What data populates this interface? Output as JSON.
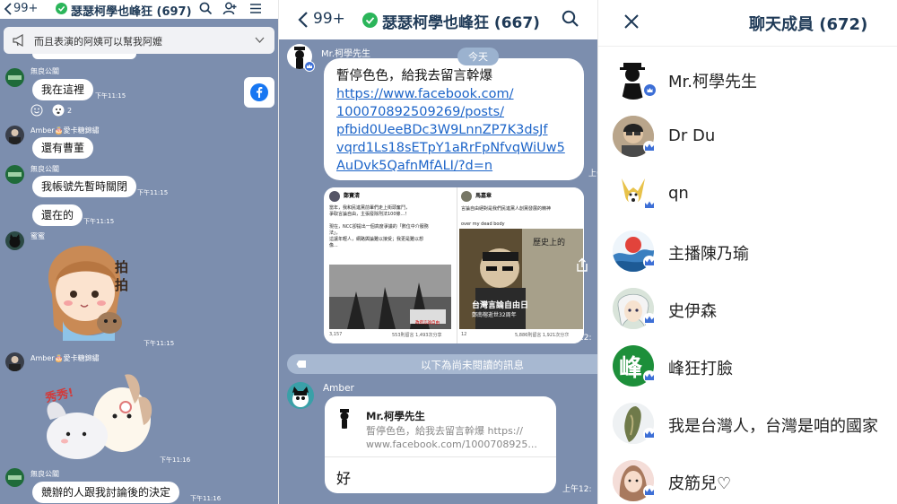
{
  "panel1": {
    "back_count": "99+",
    "title": "瑟瑟柯學也峰狂 (697)",
    "announcement": "而且表演的阿姨可以幫我阿嬤",
    "messages": [
      {
        "sender": "無良公關",
        "text": "我在這裡",
        "time": "下午11:15",
        "reaction_count": "2"
      },
      {
        "sender": "Amber🎂愛卡糖錦繡",
        "text": "還有曹董",
        "time": ""
      },
      {
        "sender": "無良公關",
        "text": "我帳號先暫時關閉",
        "time": "下午11:15"
      },
      {
        "sender": "",
        "text": "還在的",
        "time": "下午11:15"
      },
      {
        "sender": "蜜蜜",
        "text": "",
        "time": "下午11:15",
        "sticker_text": "拍拍"
      },
      {
        "sender": "Amber🎂愛卡糖錦繡",
        "text": "",
        "time": "下午11:16",
        "sticker_text": "秀秀!"
      },
      {
        "sender": "無良公關",
        "text": "競辦的人跟我討論後的決定",
        "time": "下午11:16"
      }
    ]
  },
  "panel2": {
    "back_count": "99+",
    "title": "瑟瑟柯學也峰狂 (667)",
    "today_label": "今天",
    "post_sender": "Mr.柯學先生",
    "post_text": "暫停色色，給我去留言幹爆",
    "post_link_lines": [
      "https://www.facebook.com/",
      "100070892509269/posts/",
      "pfbid0UeeBDc3W9LnnZP7K3dsJf",
      "vqrd1Ls18sETpY1aRrFpNfvqWiUw5",
      "AuDvk5QafnMfALI/?d=n"
    ],
    "post_time": "上午1",
    "image_time": "上午12:",
    "fb_left": {
      "author": "鄭寶清",
      "text_lines": [
        "當年，我和民進黨前輩們走上街頭奮鬥，",
        "爭取言論自由，主張廢除刑法100條...！",
        "",
        "現在，NCC卻提出一個高度爭議的「數位中介服務",
        "法」，",
        "這讓年輕人，網路輿論難以接受；我更是難以想",
        "像..."
      ],
      "caption": "政府言論自由",
      "likes": "3,157",
      "stats": "553則留言   1,493次分享"
    },
    "fb_right": {
      "author": "馬嘉章",
      "text_lines": [
        "言論自由絕對是我們民進黨人創黨發展的精神"
      ],
      "sub": "over my dead body",
      "img_text": "歷史上的",
      "headline": "台灣言論自由日",
      "headline_sub": "鄭南榕逝世32周年",
      "likes": "12",
      "stats": "5,886則留言   1,921次分享"
    },
    "unread_label": "以下為尚未閱讀的訊息",
    "reply_sender": "Amber",
    "reply_quote_name": "Mr.柯學先生",
    "reply_quote_lines": [
      "暫停色色，給我去留言幹爆 https://",
      "www.facebook.com/1000708925..."
    ],
    "reply_text": "好",
    "reply_time": "上午12:"
  },
  "panel3": {
    "title": "聊天成員 (672)",
    "members": [
      {
        "name": "Mr.柯學先生",
        "avatar": "silhouette-hat"
      },
      {
        "name": "Dr Du",
        "avatar": "portrait"
      },
      {
        "name": "qn",
        "avatar": "dog"
      },
      {
        "name": "主播陳乃瑜",
        "avatar": "wave"
      },
      {
        "name": "史伊森",
        "avatar": "anime-hair"
      },
      {
        "name": "峰狂打臉",
        "avatar": "green-logo",
        "avatar_char": "峰"
      },
      {
        "name": "我是台灣人，台灣是咱的國家",
        "avatar": "taiwan-map"
      },
      {
        "name": "皮筋兒♡",
        "avatar": "girl"
      }
    ]
  },
  "colors": {
    "chat_bg": "#7c8eae",
    "title": "#1f3a57",
    "link": "#1c64c8",
    "crown": "#3d6fd6"
  }
}
